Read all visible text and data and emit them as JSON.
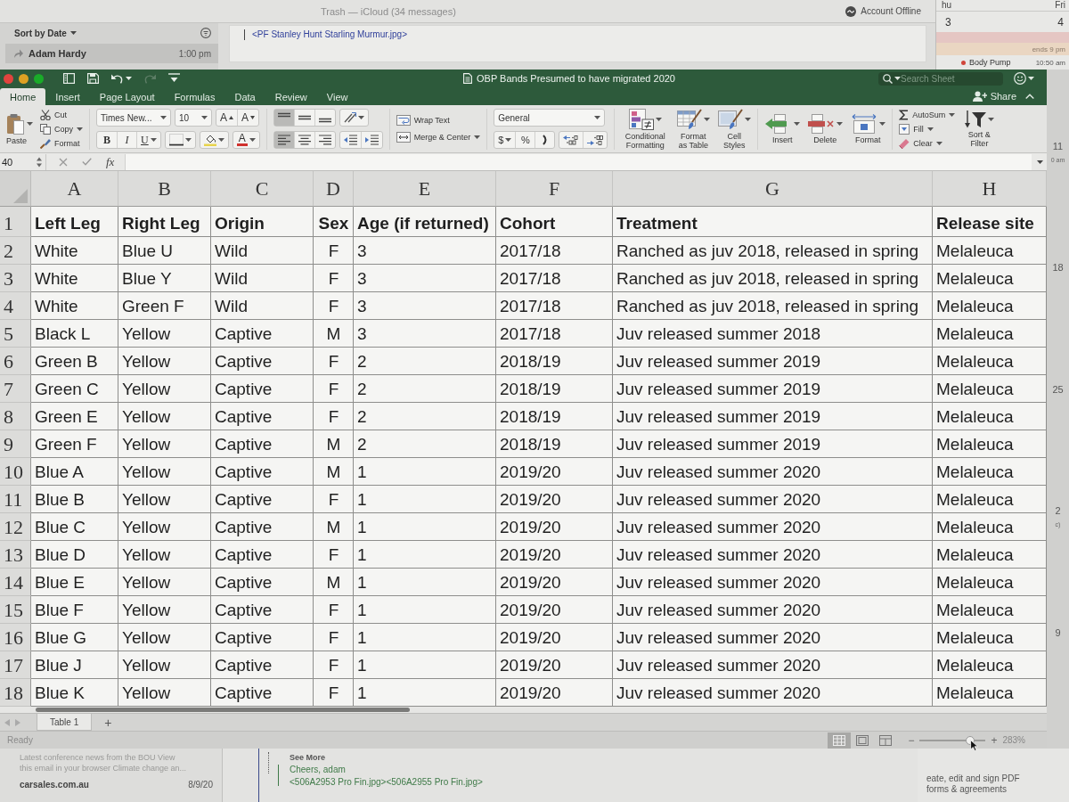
{
  "background_mail": {
    "title": "Trash — iCloud (34 messages)",
    "account_status": "Account Offline",
    "sort": "Sort by Date",
    "message": {
      "sender": "Adam Hardy",
      "time": "1:00 pm"
    },
    "attachment": "<PF Stanley Hunt Starling Murmur.jpg>"
  },
  "background_calendar": {
    "days": [
      "hu",
      "Fri"
    ],
    "dates": [
      "3",
      "4"
    ],
    "banner": "ends 9 pm",
    "event": {
      "title": "Body Pump",
      "time": "10:50 am"
    },
    "weeks": [
      {
        "date": "11",
        "note": "0 am"
      },
      {
        "date": "18"
      },
      {
        "date": "25"
      },
      {
        "date": "2",
        "note": "c)"
      },
      {
        "date": "9"
      }
    ]
  },
  "window": {
    "title": "OBP Bands Presumed to have migrated 2020",
    "quick_access": [
      {
        "kind": "sidebar",
        "disabled": false
      },
      {
        "kind": "save",
        "disabled": false
      },
      {
        "kind": "undo",
        "disabled": false
      },
      {
        "kind": "redo",
        "disabled": true
      },
      {
        "kind": "customize",
        "disabled": false
      }
    ],
    "search": {
      "placeholder": "Search Sheet"
    }
  },
  "tabs": [
    {
      "label": "Home",
      "selected": true
    },
    {
      "label": "Insert",
      "selected": false
    },
    {
      "label": "Page Layout",
      "selected": false
    },
    {
      "label": "Formulas",
      "selected": false
    },
    {
      "label": "Data",
      "selected": false
    },
    {
      "label": "Review",
      "selected": false
    },
    {
      "label": "View",
      "selected": false
    }
  ],
  "share": "Share",
  "ribbon": {
    "clipboard": {
      "paste": "Paste",
      "cut": "Cut",
      "copy": "Copy",
      "format_painter": "Format"
    },
    "font": {
      "name": "Times New...",
      "size": "10",
      "grow": "A",
      "shrink": "A",
      "styles": [
        {
          "kind": "bold",
          "label": "B"
        },
        {
          "kind": "italic",
          "label": "I"
        },
        {
          "kind": "underline",
          "label": "U"
        }
      ],
      "font_color": "A"
    },
    "alignment": {
      "vertical": [
        {
          "kind": "top",
          "selected": true
        },
        {
          "kind": "middle",
          "selected": false
        },
        {
          "kind": "bottom",
          "selected": false
        }
      ],
      "horizontal": [
        {
          "kind": "left",
          "selected": true
        },
        {
          "kind": "center",
          "selected": false
        },
        {
          "kind": "right",
          "selected": false
        }
      ],
      "wrap_text": "Wrap Text",
      "merge": "Merge & Center"
    },
    "number": {
      "format": "General",
      "currency": "$",
      "percent": "%"
    },
    "styles": [
      {
        "kind": "conditional",
        "label": "Conditional Formatting"
      },
      {
        "kind": "table",
        "label": "Format as Table"
      },
      {
        "kind": "cell",
        "label": "Cell Styles"
      }
    ],
    "cells": [
      {
        "kind": "insert",
        "label": "Insert"
      },
      {
        "kind": "delete",
        "label": "Delete"
      },
      {
        "kind": "format",
        "label": "Format"
      }
    ],
    "editing": {
      "autosum": "AutoSum",
      "fill": "Fill",
      "clear": "Clear",
      "sort_filter": "Sort & Filter"
    }
  },
  "formula_bar": {
    "name_box": "40",
    "function_label": "fx"
  },
  "sheet": {
    "columns": [
      "A",
      "B",
      "C",
      "D",
      "E",
      "F",
      "G",
      "H"
    ],
    "rows": [
      {
        "number": "1",
        "kind": "header",
        "cells": [
          "Left Leg",
          "Right Leg",
          "Origin",
          "Sex",
          "Age (if returned)",
          "Cohort",
          "Treatment",
          "Release site"
        ]
      },
      {
        "number": "2",
        "kind": "data",
        "cells": [
          "White",
          "Blue U",
          "Wild",
          "F",
          "3",
          "2017/18",
          "Ranched as juv 2018, released in spring",
          "Melaleuca"
        ]
      },
      {
        "number": "3",
        "kind": "data",
        "cells": [
          "White",
          "Blue Y",
          "Wild",
          "F",
          "3",
          "2017/18",
          "Ranched as juv 2018, released in spring",
          "Melaleuca"
        ]
      },
      {
        "number": "4",
        "kind": "data",
        "cells": [
          "White",
          "Green F",
          "Wild",
          "F",
          "3",
          "2017/18",
          "Ranched as juv 2018, released in spring",
          "Melaleuca"
        ]
      },
      {
        "number": "5",
        "kind": "data",
        "cells": [
          "Black L",
          "Yellow",
          "Captive",
          "M",
          "3",
          "2017/18",
          "Juv released summer 2018",
          "Melaleuca"
        ]
      },
      {
        "number": "6",
        "kind": "data",
        "cells": [
          "Green B",
          "Yellow",
          "Captive",
          "F",
          "2",
          "2018/19",
          "Juv released summer 2019",
          "Melaleuca"
        ]
      },
      {
        "number": "7",
        "kind": "data",
        "cells": [
          "Green C",
          "Yellow",
          "Captive",
          "F",
          "2",
          "2018/19",
          "Juv released summer 2019",
          "Melaleuca"
        ]
      },
      {
        "number": "8",
        "kind": "data",
        "cells": [
          "Green E",
          "Yellow",
          "Captive",
          "F",
          "2",
          "2018/19",
          "Juv released summer 2019",
          "Melaleuca"
        ]
      },
      {
        "number": "9",
        "kind": "data",
        "cells": [
          "Green F",
          "Yellow",
          "Captive",
          "M",
          "2",
          "2018/19",
          "Juv released summer 2019",
          "Melaleuca"
        ]
      },
      {
        "number": "10",
        "kind": "data",
        "cells": [
          "Blue A",
          "Yellow",
          "Captive",
          "M",
          "1",
          "2019/20",
          "Juv released summer 2020",
          "Melaleuca"
        ]
      },
      {
        "number": "11",
        "kind": "data",
        "cells": [
          "Blue B",
          "Yellow",
          "Captive",
          "F",
          "1",
          "2019/20",
          "Juv released summer 2020",
          "Melaleuca"
        ]
      },
      {
        "number": "12",
        "kind": "data",
        "cells": [
          "Blue C",
          "Yellow",
          "Captive",
          "M",
          "1",
          "2019/20",
          "Juv released summer 2020",
          "Melaleuca"
        ]
      },
      {
        "number": "13",
        "kind": "data",
        "cells": [
          "Blue D",
          "Yellow",
          "Captive",
          "F",
          "1",
          "2019/20",
          "Juv released summer 2020",
          "Melaleuca"
        ]
      },
      {
        "number": "14",
        "kind": "data",
        "cells": [
          "Blue E",
          "Yellow",
          "Captive",
          "M",
          "1",
          "2019/20",
          "Juv released summer 2020",
          "Melaleuca"
        ]
      },
      {
        "number": "15",
        "kind": "data",
        "cells": [
          "Blue F",
          "Yellow",
          "Captive",
          "F",
          "1",
          "2019/20",
          "Juv released summer 2020",
          "Melaleuca"
        ]
      },
      {
        "number": "16",
        "kind": "data",
        "cells": [
          "Blue G",
          "Yellow",
          "Captive",
          "F",
          "1",
          "2019/20",
          "Juv released summer 2020",
          "Melaleuca"
        ]
      },
      {
        "number": "17",
        "kind": "data",
        "cells": [
          "Blue J",
          "Yellow",
          "Captive",
          "F",
          "1",
          "2019/20",
          "Juv released summer 2020",
          "Melaleuca"
        ]
      },
      {
        "number": "18",
        "kind": "data",
        "cells": [
          "Blue K",
          "Yellow",
          "Captive",
          "F",
          "1",
          "2019/20",
          "Juv released summer 2020",
          "Melaleuca"
        ]
      }
    ]
  },
  "sheet_tabs": {
    "items": [
      {
        "label": "Table 1",
        "selected": true
      }
    ],
    "add": "+"
  },
  "status_bar": {
    "status": "Ready",
    "views": [
      {
        "kind": "normal",
        "selected": true
      },
      {
        "kind": "page_layout",
        "selected": false
      },
      {
        "kind": "page_break",
        "selected": false
      }
    ],
    "zoom_out": "−",
    "zoom_in": "+",
    "zoom": {
      "level": 0.77
    },
    "zoom_reading": "283%"
  },
  "background_bottom": {
    "preview_lines": [
      "Latest conference news from the BOU View",
      "this email in your browser Climate change an..."
    ],
    "sender": "carsales.com.au",
    "date": "8/9/20",
    "see_more": "See More",
    "quote": [
      "Cheers, adam",
      "<506A2953 Pro Fin.jpg><506A2955 Pro Fin.jpg>"
    ],
    "ad_lines": [
      "eate, edit and sign PDF",
      "forms & agreements"
    ]
  }
}
